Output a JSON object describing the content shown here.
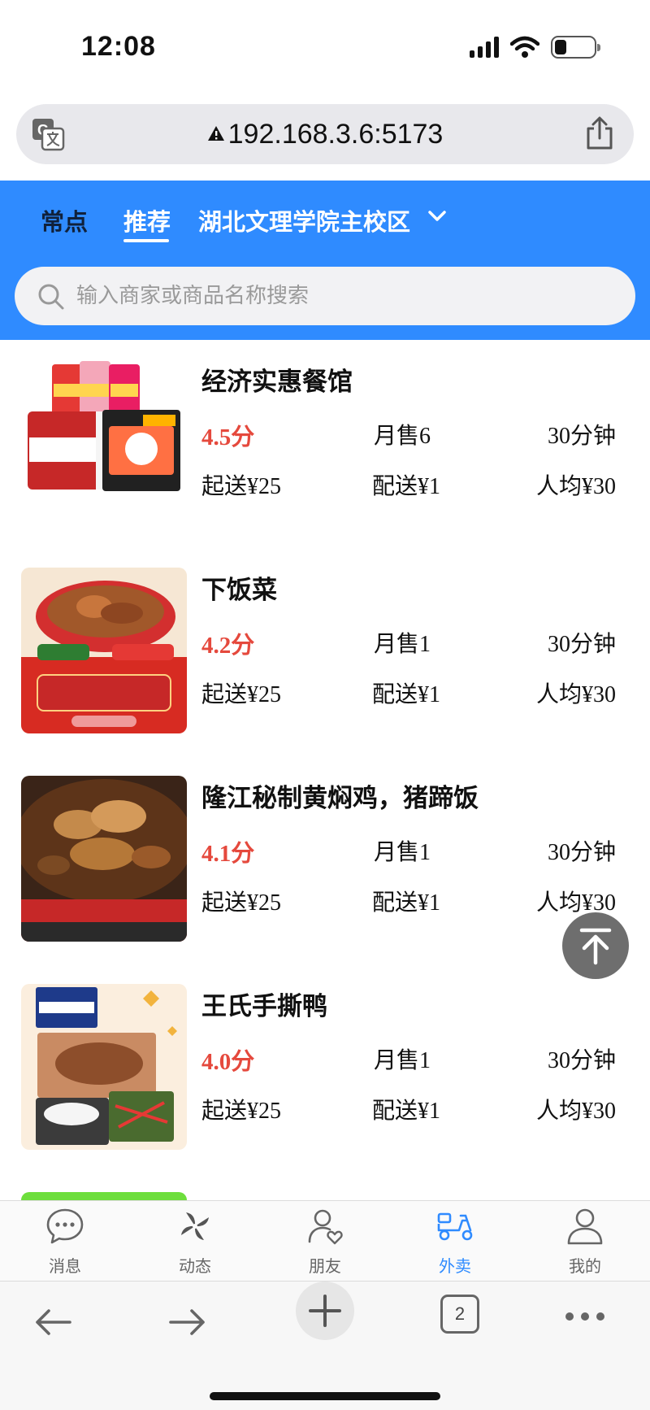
{
  "status": {
    "time": "12:08"
  },
  "browser": {
    "url": "192.168.3.6:5173",
    "tab_count": "2"
  },
  "header": {
    "tabs": [
      "常点",
      "推荐"
    ],
    "campus": "湖北文理学院主校区",
    "search_placeholder": "输入商家或商品名称搜索"
  },
  "shops": [
    {
      "name": "经济实惠餐馆",
      "score": "4.5分",
      "sales": "月售6",
      "time": "30分钟",
      "min": "起送¥25",
      "fee": "配送¥1",
      "avg": "人均¥30",
      "image": "snacks-drinks"
    },
    {
      "name": "下饭菜",
      "score": "4.2分",
      "sales": "月售1",
      "time": "30分钟",
      "min": "起送¥25",
      "fee": "配送¥1",
      "avg": "人均¥30",
      "image": "dry-pot-dish"
    },
    {
      "name": "隆江秘制黄焖鸡，猪蹄饭",
      "score": "4.1分",
      "sales": "月售1",
      "time": "30分钟",
      "min": "起送¥25",
      "fee": "配送¥1",
      "avg": "人均¥30",
      "image": "braised-chicken"
    },
    {
      "name": "王氏手撕鸭",
      "score": "4.0分",
      "sales": "月售1",
      "time": "30分钟",
      "min": "起送¥25",
      "fee": "配送¥1",
      "avg": "人均¥30",
      "image": "duck-meal"
    }
  ],
  "tabbar": [
    {
      "label": "消息",
      "icon": "chat-icon"
    },
    {
      "label": "动态",
      "icon": "pinwheel-icon"
    },
    {
      "label": "朋友",
      "icon": "friends-icon"
    },
    {
      "label": "外卖",
      "icon": "scooter-icon"
    },
    {
      "label": "我的",
      "icon": "person-icon"
    }
  ],
  "colors": {
    "primary": "#2f8bff",
    "score": "#e5493d"
  }
}
